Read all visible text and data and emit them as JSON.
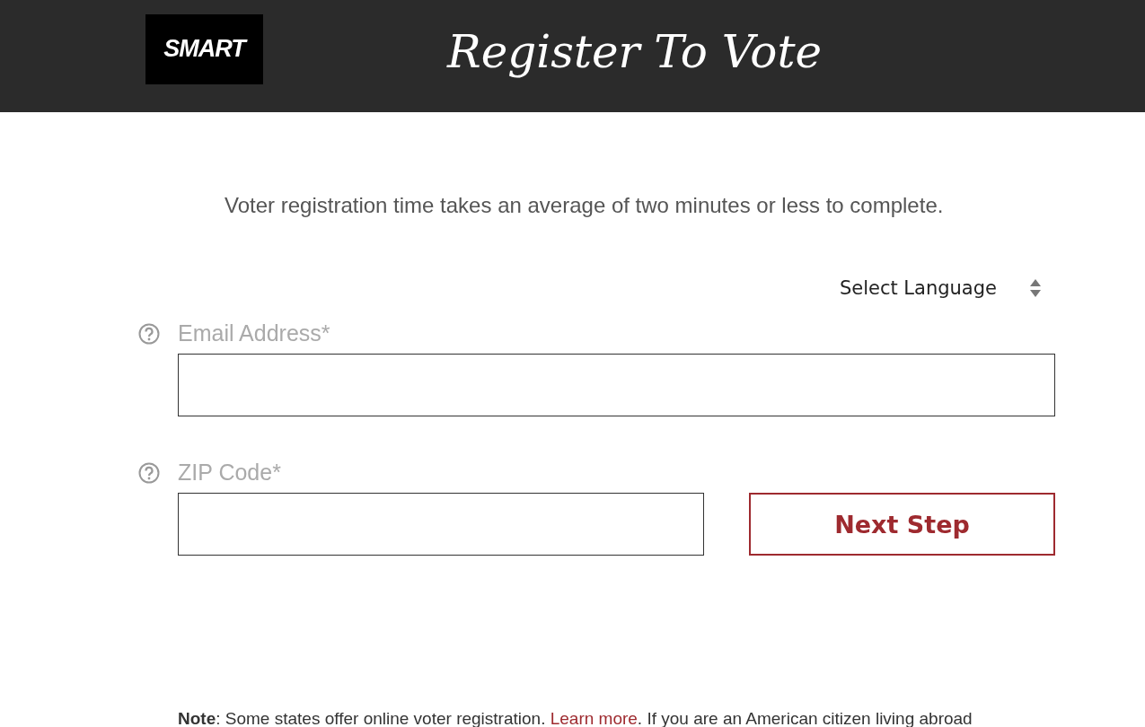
{
  "header": {
    "logo": "SMART",
    "title": "Register To Vote"
  },
  "intro": "Voter registration time takes an average of two minutes or less to complete.",
  "language_select": {
    "label": "Select Language"
  },
  "fields": [
    {
      "label": "Email Address*"
    },
    {
      "label": "ZIP Code*"
    }
  ],
  "next_button": "Next Step",
  "note": {
    "label": "Note",
    "text_before": ": Some states offer online voter registration. ",
    "link": "Learn more",
    "text_after": ". If you are an American citizen living abroad"
  }
}
